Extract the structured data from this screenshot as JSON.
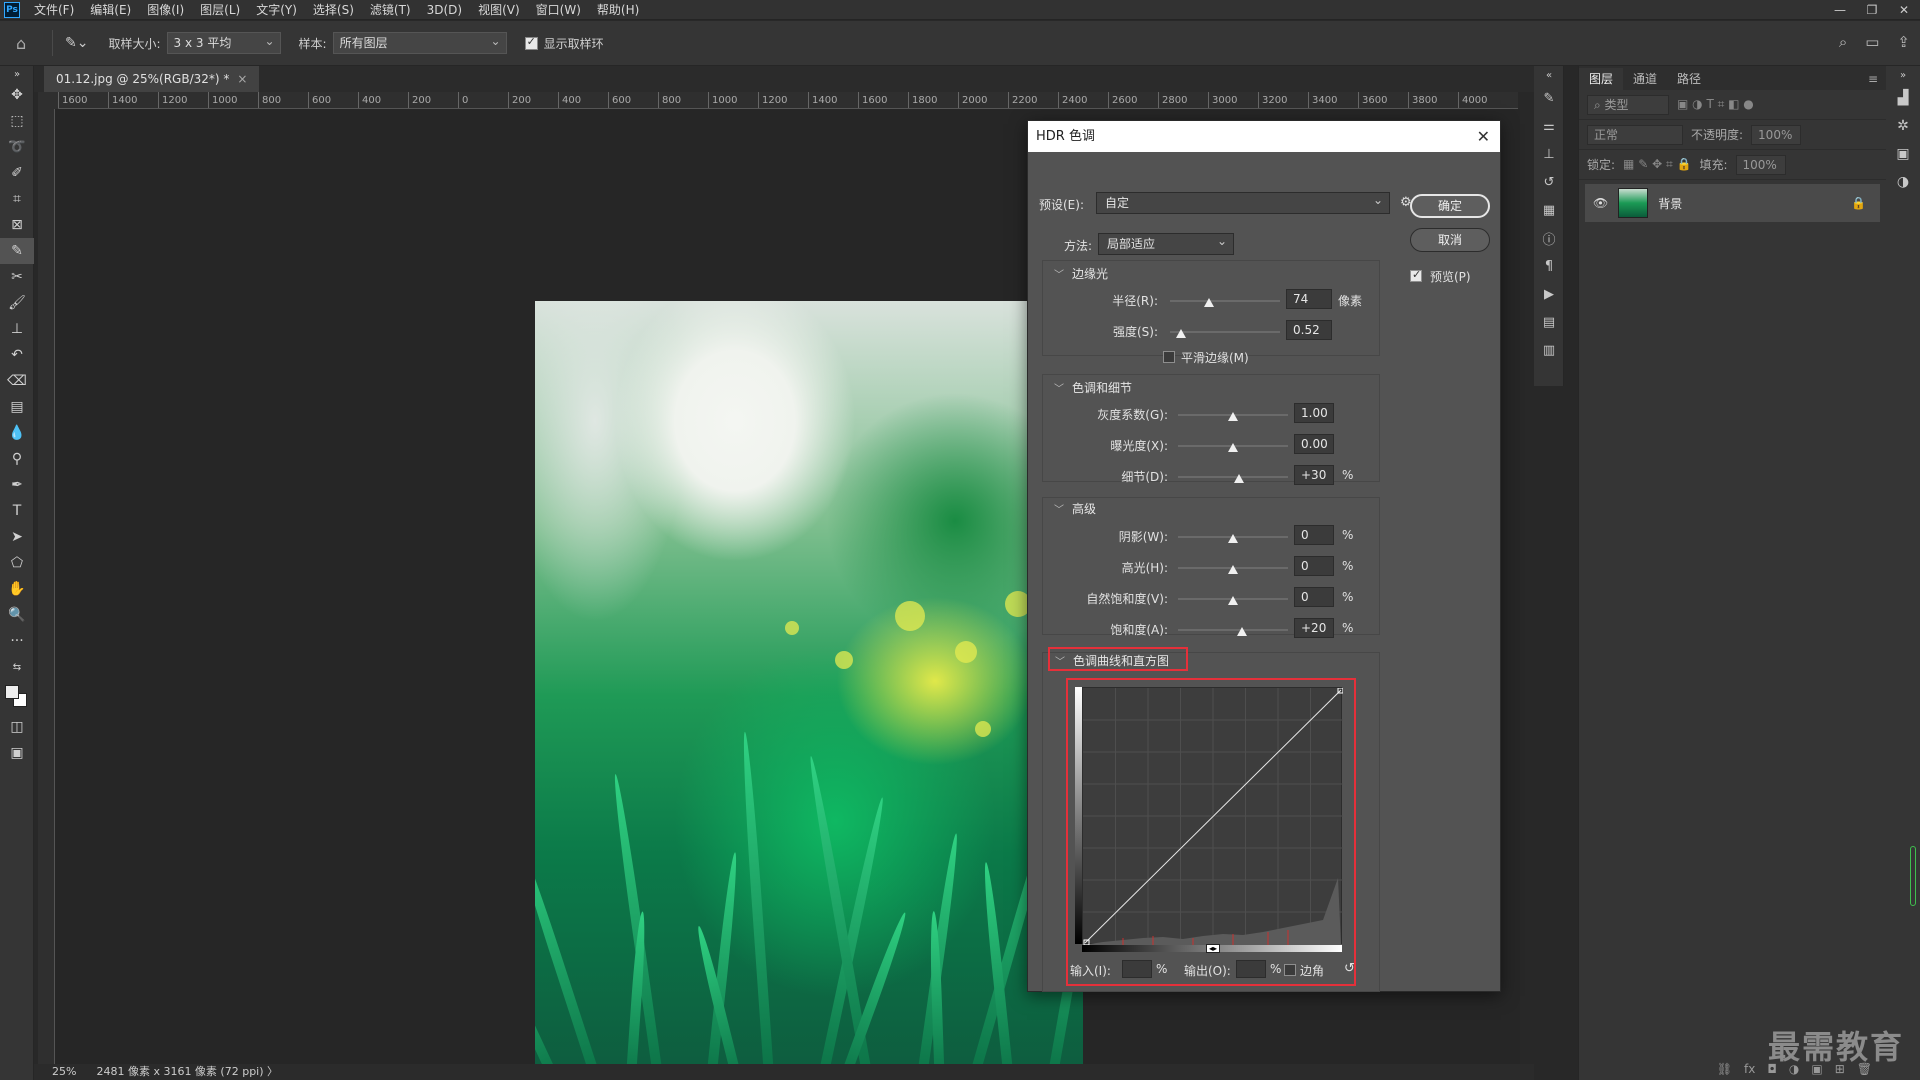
{
  "menubar": {
    "logo": "Ps",
    "items": [
      "文件(F)",
      "编辑(E)",
      "图像(I)",
      "图层(L)",
      "文字(Y)",
      "选择(S)",
      "滤镜(T)",
      "3D(D)",
      "视图(V)",
      "窗口(W)",
      "帮助(H)"
    ],
    "window_controls": [
      "—",
      "❐",
      "✕"
    ]
  },
  "optbar": {
    "sample_size_label": "取样大小:",
    "sample_size_value": "3 x 3 平均",
    "sample_label": "样本:",
    "sample_value": "所有图层",
    "show_ring_label": "显示取样环"
  },
  "document": {
    "tab_title": "01.12.jpg @ 25%(RGB/32*) *",
    "tab_close": "×",
    "ruler_labels": [
      "1600",
      "1400",
      "1200",
      "1000",
      "800",
      "600",
      "400",
      "200",
      "0",
      "200",
      "400",
      "600",
      "800",
      "1000",
      "1200",
      "1400",
      "1600",
      "1800",
      "2000",
      "2200",
      "2400",
      "2600",
      "2800",
      "3000",
      "3200",
      "3400",
      "3600",
      "3800",
      "4000"
    ],
    "zoom": "25%",
    "dimensions": "2481 像素 x 3161 像素 (72 ppi)",
    "status_arrow": "〉"
  },
  "dialog": {
    "title": "HDR 色调",
    "preset_label": "预设(E):",
    "preset_value": "自定",
    "ok_label": "确定",
    "cancel_label": "取消",
    "preview_label": "预览(P)",
    "method_label": "方法:",
    "method_value": "局部适应",
    "edge_glow": {
      "title": "边缘光",
      "radius_label": "半径(R):",
      "radius_value": "74",
      "radius_unit": "像素",
      "radius_pos": 0.35,
      "strength_label": "强度(S):",
      "strength_value": "0.52",
      "strength_pos": 0.1,
      "smooth_label": "平滑边缘(M)"
    },
    "tone_detail": {
      "title": "色调和细节",
      "gamma_label": "灰度系数(G):",
      "gamma_value": "1.00",
      "gamma_pos": 0.5,
      "exposure_label": "曝光度(X):",
      "exposure_value": "0.00",
      "exposure_pos": 0.5,
      "detail_label": "细节(D):",
      "detail_value": "+30",
      "detail_unit": "%",
      "detail_pos": 0.55
    },
    "advanced": {
      "title": "高级",
      "shadow_label": "阴影(W):",
      "shadow_value": "0",
      "shadow_pos": 0.5,
      "highlight_label": "高光(H):",
      "highlight_value": "0",
      "highlight_pos": 0.5,
      "vibrance_label": "自然饱和度(V):",
      "vibrance_value": "0",
      "vibrance_pos": 0.5,
      "saturation_label": "饱和度(A):",
      "saturation_value": "+20",
      "saturation_pos": 0.58,
      "unit": "%"
    },
    "curve": {
      "title": "色调曲线和直方图",
      "input_label": "输入(I):",
      "output_label": "输出(O):",
      "percent": "%",
      "corner_label": "边角",
      "reset_icon": "↺"
    }
  },
  "layers_panel": {
    "tabs": [
      "图层",
      "通道",
      "路径"
    ],
    "filter_placeholder": "类型",
    "blend_mode": "正常",
    "opacity_label": "不透明度:",
    "opacity_value": "100%",
    "lock_label": "锁定:",
    "fill_label": "填充:",
    "fill_value": "100%",
    "layer_name": "背景",
    "bottom_icons": [
      "⛓",
      "fx",
      "◘",
      "◑",
      "▣",
      "⊞",
      "🗑"
    ]
  },
  "watermark": "最需教育"
}
